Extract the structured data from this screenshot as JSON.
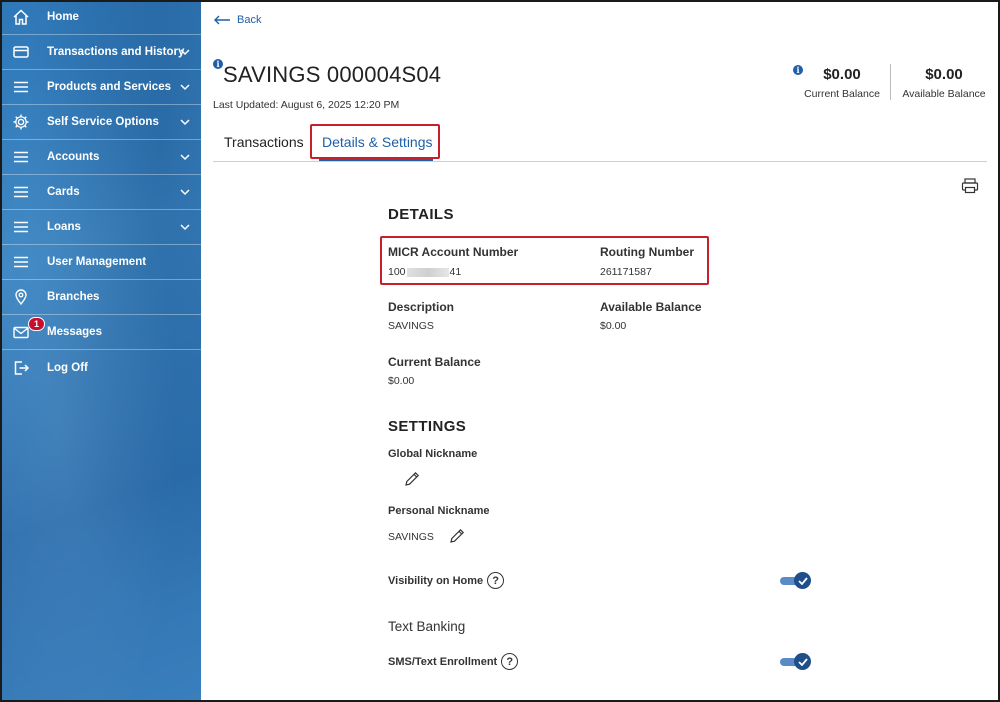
{
  "sidebar": {
    "items": [
      {
        "label": "Home",
        "icon": "home-icon"
      },
      {
        "label": "Transactions and History",
        "icon": "card-icon"
      },
      {
        "label": "Products and Services",
        "icon": "menu-icon"
      },
      {
        "label": "Self Service Options",
        "icon": "gear-icon"
      },
      {
        "label": "Accounts",
        "icon": "menu-icon"
      },
      {
        "label": "Cards",
        "icon": "menu-icon"
      },
      {
        "label": "Loans",
        "icon": "menu-icon"
      },
      {
        "label": "User Management",
        "icon": "menu-icon"
      },
      {
        "label": "Branches",
        "icon": "location-icon"
      },
      {
        "label": "Messages",
        "icon": "mail-icon",
        "badge": "1"
      },
      {
        "label": "Log Off",
        "icon": "logout-icon"
      }
    ]
  },
  "header": {
    "back_label": "Back",
    "account_title": "SAVINGS 000004S04",
    "last_updated": "Last Updated: August 6, 2025 12:20 PM",
    "current_balance": "$0.00",
    "current_balance_label": "Current Balance",
    "available_balance": "$0.00",
    "available_balance_label": "Available Balance"
  },
  "tabs": [
    {
      "label": "Transactions"
    },
    {
      "label": "Details & Settings",
      "active": true
    }
  ],
  "details": {
    "heading": "DETAILS",
    "micr_label": "MICR Account Number",
    "micr_prefix": "100",
    "micr_suffix": "41",
    "routing_label": "Routing Number",
    "routing_value": "261171587",
    "description_label": "Description",
    "description_value": "SAVINGS",
    "available_label": "Available Balance",
    "available_value": "$0.00",
    "current_label": "Current Balance",
    "current_value": "$0.00"
  },
  "settings": {
    "heading": "SETTINGS",
    "global_nickname_label": "Global Nickname",
    "personal_nickname_label": "Personal Nickname",
    "personal_nickname_value": "SAVINGS",
    "visibility_label": "Visibility on Home",
    "visibility_on": true,
    "text_banking_heading": "Text Banking",
    "sms_label": "SMS/Text Enrollment",
    "sms_on": true
  },
  "colors": {
    "accent": "#1f5fa8",
    "sidebar": "#3a7fbd",
    "highlight_box": "#c8202b",
    "badge": "#c8102e"
  }
}
